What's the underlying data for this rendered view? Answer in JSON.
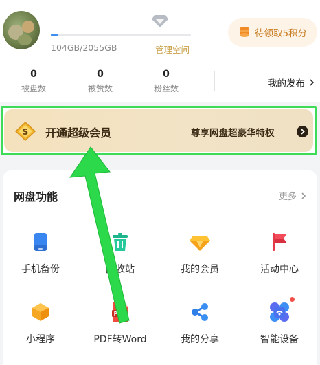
{
  "profile": {
    "storage_text": "104GB/2055GB",
    "storage_fraction": 0.05,
    "manage_space_label": "管理空间",
    "points_button_label": "待领取5积分"
  },
  "stats": [
    {
      "value": "0",
      "label": "被盘数"
    },
    {
      "value": "0",
      "label": "被赞数"
    },
    {
      "value": "0",
      "label": "粉丝数"
    }
  ],
  "my_publish_label": "我的发布",
  "vip_banner": {
    "badge_letter": "S",
    "title": "开通超级会员",
    "description": "尊享网盘超豪华特权"
  },
  "functions": {
    "title": "网盘功能",
    "more_label": "更多",
    "items": [
      {
        "label": "手机备份",
        "icon": "phone-backup-icon"
      },
      {
        "label": "回收站",
        "icon": "recycle-bin-icon"
      },
      {
        "label": "我的会员",
        "icon": "membership-diamond-icon"
      },
      {
        "label": "活动中心",
        "icon": "activity-flag-icon"
      },
      {
        "label": "小程序",
        "icon": "mini-program-icon"
      },
      {
        "label": "PDF转Word",
        "icon": "pdf-icon",
        "icon_text": "PDF"
      },
      {
        "label": "我的分享",
        "icon": "share-icon"
      },
      {
        "label": "智能设备",
        "icon": "smart-device-icon"
      }
    ]
  },
  "colors": {
    "accent_blue": "#3d8ef0",
    "gold_text": "#c9a14a",
    "highlight_green": "#3ddb57"
  }
}
